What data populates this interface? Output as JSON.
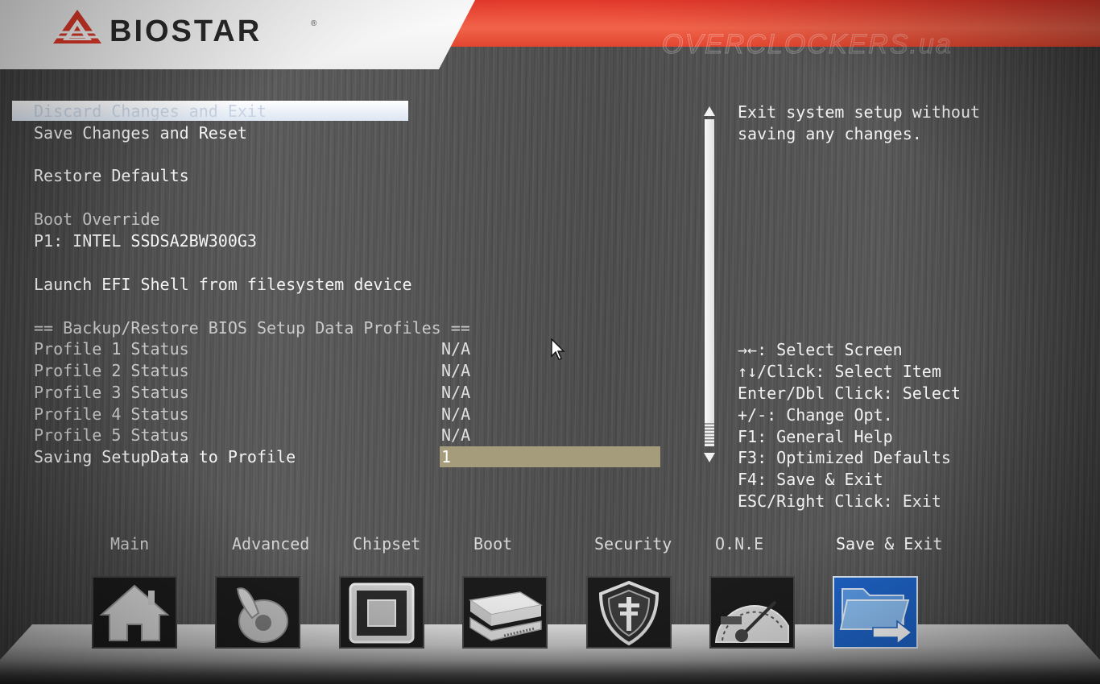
{
  "header": {
    "brand": "BIOSTAR",
    "brand_reg": "®",
    "watermark": "OVERCLOCKERS.ua"
  },
  "menu": {
    "items": [
      {
        "label": "Discard Changes and Exit",
        "selected": true
      },
      {
        "label": "Save Changes and Reset"
      },
      {
        "label": "Restore Defaults"
      },
      {
        "label": "Boot Override",
        "dim": true
      },
      {
        "label": "P1: INTEL SSDSA2BW300G3"
      },
      {
        "label": "Launch EFI Shell from filesystem device"
      },
      {
        "label": "== Backup/Restore BIOS Setup Data Profiles ==",
        "dim": true
      }
    ],
    "profiles": [
      {
        "label": "Profile 1 Status",
        "value": "N/A"
      },
      {
        "label": "Profile 2 Status",
        "value": "N/A"
      },
      {
        "label": "Profile 3 Status",
        "value": "N/A"
      },
      {
        "label": "Profile 4 Status",
        "value": "N/A"
      },
      {
        "label": "Profile 5 Status",
        "value": "N/A"
      }
    ],
    "saving": {
      "label": "Saving SetupData to Profile",
      "value": "1"
    }
  },
  "help": {
    "description": [
      "Exit system setup without",
      "saving any changes."
    ],
    "keys": [
      "→←: Select Screen",
      "↑↓/Click: Select Item",
      "Enter/Dbl Click: Select",
      "+/-: Change Opt.",
      "F1: General Help",
      "F3: Optimized Defaults",
      "F4: Save & Exit",
      "ESC/Right Click: Exit"
    ]
  },
  "tabs": [
    {
      "label": "Main",
      "icon": "home-icon"
    },
    {
      "label": "Advanced",
      "icon": "joystick-icon"
    },
    {
      "label": "Chipset",
      "icon": "chip-icon"
    },
    {
      "label": "Boot",
      "icon": "drive-icon"
    },
    {
      "label": "Security",
      "icon": "shield-icon"
    },
    {
      "label": "O.N.E",
      "icon": "speedometer-icon"
    },
    {
      "label": "Save & Exit",
      "icon": "folder-arrow-icon",
      "active": true
    }
  ],
  "colors": {
    "header_red": "#e83a2c",
    "value_box": "#a59c7b",
    "active_tab": "#1e64c8"
  }
}
